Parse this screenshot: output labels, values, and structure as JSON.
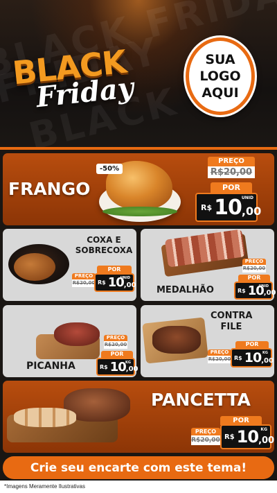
{
  "header": {
    "bg_words": [
      "BLACK FRIDAY",
      "FRIDAY",
      "BLACK"
    ],
    "black": "BLACK",
    "friday": "Friday",
    "logo_lines": [
      "SUA",
      "LOGO",
      "AQUI"
    ]
  },
  "products": {
    "frango": {
      "name": "FRANGO",
      "badge": "-50%",
      "preco_label": "PREÇO",
      "old_price": "R$20,00",
      "por_label": "POR",
      "currency": "R$",
      "price_int": "10",
      "price_cents": ",00",
      "unit": "UNID"
    },
    "coxa": {
      "name_line1": "COXA E",
      "name_line2": "SOBRECOXA",
      "preco_label": "PREÇO",
      "old_price": "R$20,00",
      "por_label": "POR",
      "currency": "R$",
      "price_int": "10",
      "price_cents": ",00",
      "unit": "UNID"
    },
    "medalhao": {
      "name": "MEDALHÃO",
      "preco_label": "PREÇO",
      "old_price": "R$20,00",
      "por_label": "POR",
      "currency": "R$",
      "price_int": "10",
      "price_cents": ",00",
      "unit": "UNID"
    },
    "picanha": {
      "name": "PICANHA",
      "preco_label": "PREÇO",
      "old_price": "R$20,00",
      "por_label": "POR",
      "currency": "R$",
      "price_int": "10",
      "price_cents": ",00",
      "unit": "KG"
    },
    "contra": {
      "name_line1": "CONTRA",
      "name_line2": "FILE",
      "preco_label": "PREÇO",
      "old_price": "R$20,00",
      "por_label": "POR",
      "currency": "R$",
      "price_int": "10",
      "price_cents": ",00",
      "unit": "KG"
    },
    "pancetta": {
      "name": "PANCETTA",
      "preco_label": "PREÇO",
      "old_price": "R$20,00",
      "por_label": "POR",
      "currency": "R$",
      "price_int": "10",
      "price_cents": ",00",
      "unit": "KG"
    }
  },
  "cta": {
    "text": "Crie seu encarte com este tema!"
  },
  "footer": {
    "disclaimer": "*Imagens Meramente Ilustrativas"
  },
  "colors": {
    "accent": "#e86a12",
    "card_orange": "#a8440c",
    "card_grey": "#d8d8d8",
    "price_box": "#111111"
  }
}
